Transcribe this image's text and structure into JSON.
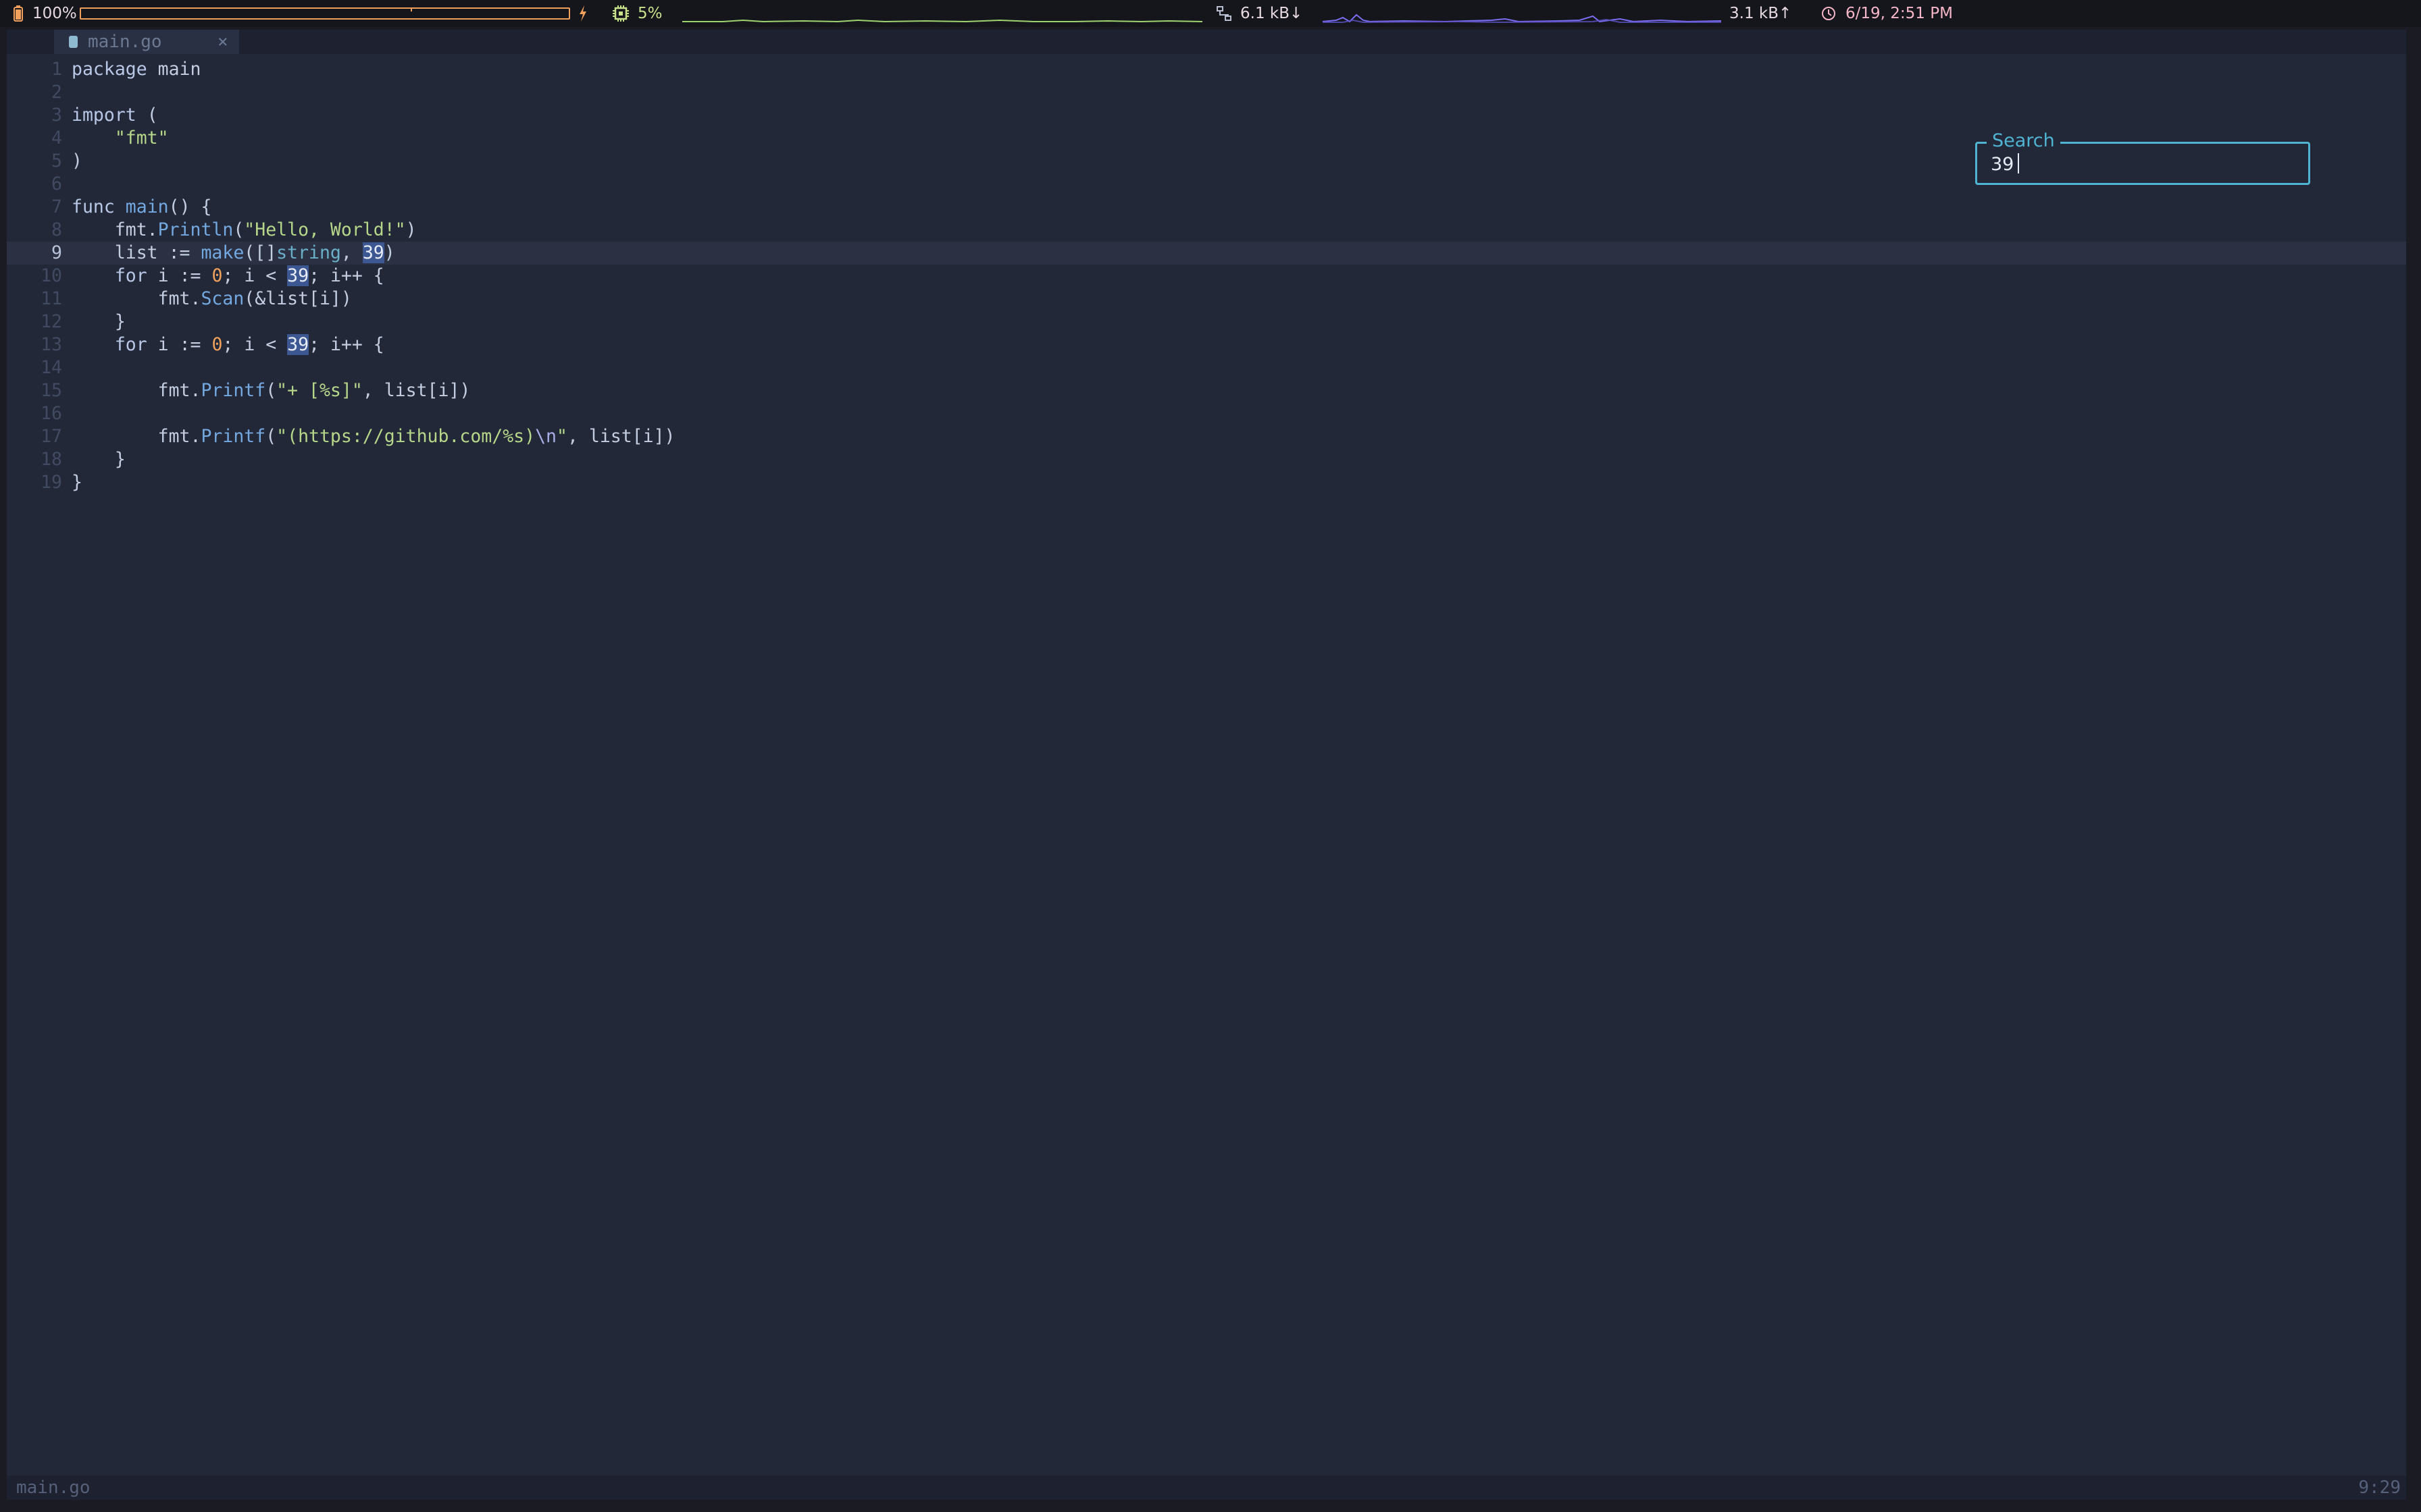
{
  "status_bar": {
    "battery": {
      "icon": "battery-icon",
      "percent_label": "100%",
      "level": 1.0,
      "charging_icon": "lightning-icon",
      "color": "#f0a05c"
    },
    "cpu": {
      "icon": "cpu-chip-icon",
      "usage_label": "5%",
      "graph_color": "#9fd36f",
      "label_color": "#c9e08a"
    },
    "network": {
      "icon": "network-icon",
      "download_label": "6.1 kB↓",
      "upload_label": "3.1 kB↑",
      "graph_color": "#7b6cf0"
    },
    "clock": {
      "icon": "clock-icon",
      "datetime_label": "6/19, 2:51 PM",
      "color": "#f4b6c7"
    }
  },
  "editor": {
    "tab": {
      "file_icon": "file-icon",
      "label": "main.go",
      "close_label": "×"
    },
    "current_line": 9,
    "lines": [
      {
        "num": "1",
        "text": "package main"
      },
      {
        "num": "2",
        "text": ""
      },
      {
        "num": "3",
        "text": "import ("
      },
      {
        "num": "4",
        "text": "    \"fmt\""
      },
      {
        "num": "5",
        "text": ")"
      },
      {
        "num": "6",
        "text": ""
      },
      {
        "num": "7",
        "text": "func main() {"
      },
      {
        "num": "8",
        "text": "    fmt.Println(\"Hello, World!\")"
      },
      {
        "num": "9",
        "text": "    list := make([]string, 39)"
      },
      {
        "num": "10",
        "text": "    for i := 0; i < 39; i++ {"
      },
      {
        "num": "11",
        "text": "        fmt.Scan(&list[i])"
      },
      {
        "num": "12",
        "text": "    }"
      },
      {
        "num": "13",
        "text": "    for i := 0; i < 39; i++ {"
      },
      {
        "num": "14",
        "text": ""
      },
      {
        "num": "15",
        "text": "        fmt.Printf(\"+ [%s]\", list[i])"
      },
      {
        "num": "16",
        "text": ""
      },
      {
        "num": "17",
        "text": "        fmt.Printf(\"(https://github.com/%s)\\n\", list[i])"
      },
      {
        "num": "18",
        "text": "    }"
      },
      {
        "num": "19",
        "text": "}"
      }
    ]
  },
  "search": {
    "label": "Search",
    "value": "39"
  },
  "bottom_bar": {
    "filename": "main.go",
    "position": "9:29"
  },
  "colors": {
    "accent": "#4fb4d1",
    "match_highlight": "#3d5793",
    "editor_bg": "#232838"
  }
}
